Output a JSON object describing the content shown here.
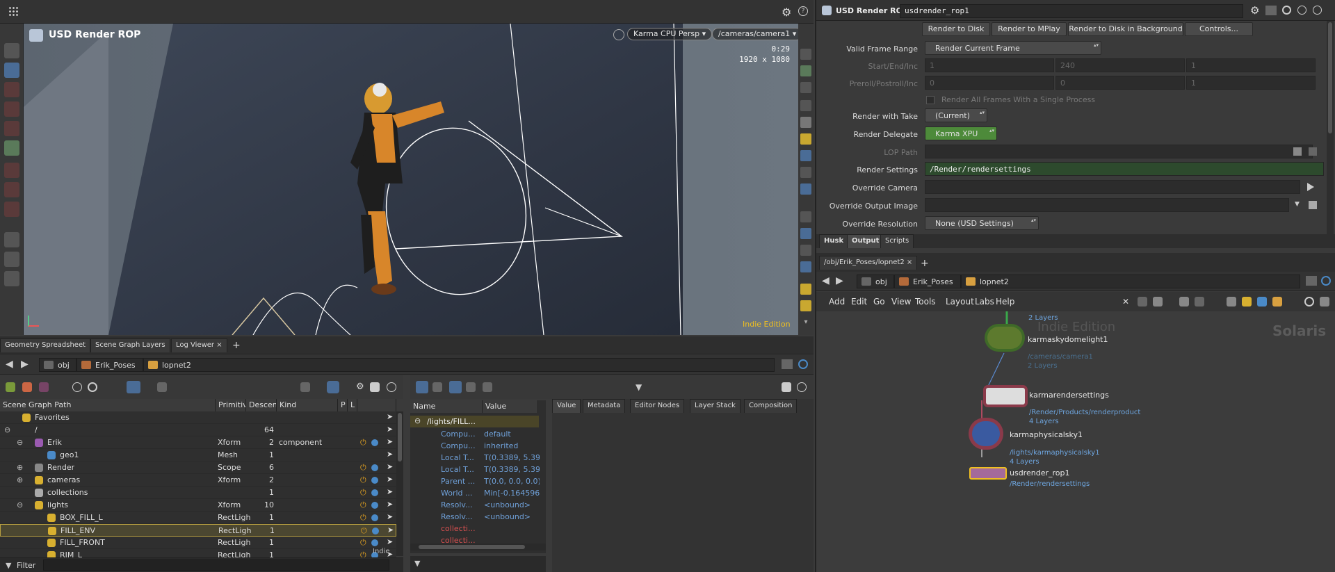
{
  "viewport": {
    "title": "USD Render ROP",
    "renderer_menu": "Karma CPU Persp",
    "camera_menu": "/cameras/camera1",
    "time": "0:29",
    "resolution": "1920 x 1080",
    "edition": "Indie Edition"
  },
  "bottom_tabs": [
    "Geometry Spreadsheet",
    "Scene Graph Layers",
    "Log Viewer"
  ],
  "left_path": [
    "obj",
    "Erik_Poses",
    "lopnet2"
  ],
  "tree": {
    "headers": [
      "Scene Graph Path",
      "Primitiv",
      "Descen",
      "Kind",
      "P",
      "L"
    ],
    "rows": [
      {
        "name": "Favorites",
        "prim": "",
        "desc": "",
        "kind": ""
      },
      {
        "name": "/",
        "prim": "",
        "desc": "64",
        "kind": ""
      },
      {
        "name": "Erik",
        "prim": "Xform",
        "desc": "2",
        "kind": "component"
      },
      {
        "name": "geo1",
        "prim": "Mesh",
        "desc": "1",
        "kind": ""
      },
      {
        "name": "Render",
        "prim": "Scope",
        "desc": "6",
        "kind": ""
      },
      {
        "name": "cameras",
        "prim": "Xform",
        "desc": "2",
        "kind": ""
      },
      {
        "name": "collections",
        "prim": "",
        "desc": "1",
        "kind": ""
      },
      {
        "name": "lights",
        "prim": "Xform",
        "desc": "10",
        "kind": ""
      },
      {
        "name": "BOX_FILL_L",
        "prim": "RectLigh",
        "desc": "1",
        "kind": ""
      },
      {
        "name": "FILL_ENV",
        "prim": "RectLigh",
        "desc": "1",
        "kind": ""
      },
      {
        "name": "FILL_FRONT",
        "prim": "RectLigh",
        "desc": "1",
        "kind": ""
      },
      {
        "name": "RIM_L",
        "prim": "RectLigh",
        "desc": "1",
        "kind": ""
      }
    ],
    "filter_label": "Filter",
    "indie_badge": "Indie"
  },
  "props": {
    "headers": [
      "Name",
      "Value"
    ],
    "group": "/lights/FILL...",
    "rows": [
      {
        "name": "Compu...",
        "value": "default"
      },
      {
        "name": "Compu...",
        "value": "inherited"
      },
      {
        "name": "Local T...",
        "value": "T(0.3389, 5.39"
      },
      {
        "name": "Local T...",
        "value": "T(0.3389, 5.39"
      },
      {
        "name": "Parent ...",
        "value": "T(0.0, 0.0, 0.0)"
      },
      {
        "name": "World ...",
        "value": "Min[-0.164596"
      },
      {
        "name": "Resolv...",
        "value": "<unbound>"
      },
      {
        "name": "Resolv...",
        "value": "<unbound>"
      },
      {
        "name": "collecti...",
        "value": ""
      },
      {
        "name": "collecti...",
        "value": ""
      }
    ]
  },
  "detail_tabs": [
    "Value",
    "Metadata",
    "Editor Nodes",
    "Layer Stack",
    "Composition"
  ],
  "rop": {
    "type_label": "USD Render ROP",
    "node_name": "usdrender_rop1",
    "buttons": [
      "Render to Disk",
      "Render to MPlay",
      "Render to Disk in Background",
      "Controls..."
    ],
    "params": [
      {
        "label": "Valid Frame Range",
        "value": "Render Current Frame"
      },
      {
        "label": "Start/End/Inc",
        "values": [
          "1",
          "240",
          "1"
        ]
      },
      {
        "label": "Preroll/Postroll/Inc",
        "values": [
          "0",
          "0",
          "1"
        ]
      },
      {
        "label": "Render All Frames With a Single Process"
      },
      {
        "label": "Render with Take",
        "value": "(Current)"
      },
      {
        "label": "Render Delegate",
        "value": "Karma XPU"
      },
      {
        "label": "LOP Path",
        "value": ""
      },
      {
        "label": "Render Settings",
        "value": "/Render/rendersettings"
      },
      {
        "label": "Override Camera",
        "value": ""
      },
      {
        "label": "Override Output Image",
        "value": ""
      },
      {
        "label": "Override Resolution",
        "value": "None (USD Settings)"
      }
    ],
    "tabs": [
      "Husk",
      "Output",
      "Scripts"
    ]
  },
  "network": {
    "tab_label": "/obj/Erik_Poses/lopnet2",
    "path": [
      "obj",
      "Erik_Poses",
      "lopnet2"
    ],
    "menu": [
      "Add",
      "Edit",
      "Go",
      "View",
      "Tools",
      "Layout",
      "Labs",
      "Help"
    ],
    "watermark": "Indie Edition",
    "context": "Solaris",
    "nodes": [
      {
        "name": "",
        "sub": "2 Layers"
      },
      {
        "name": "karmaskydomelight1",
        "sub": "/cameras/camera1",
        "sub2": "2 Layers"
      },
      {
        "name": "karmarendersettings",
        "sub": "/Render/Products/renderproduct",
        "sub2": "4 Layers"
      },
      {
        "name": "karmaphysicalsky1",
        "sub": "/lights/karmaphysicalsky1",
        "sub2": "4 Layers"
      },
      {
        "name": "usdrender_rop1",
        "sub": "/Render/rendersettings"
      }
    ]
  },
  "colors": {
    "accent_yellow": "#d8b030",
    "karma_green": "#4d8a3a",
    "settings_green": "#2d4a2d"
  }
}
